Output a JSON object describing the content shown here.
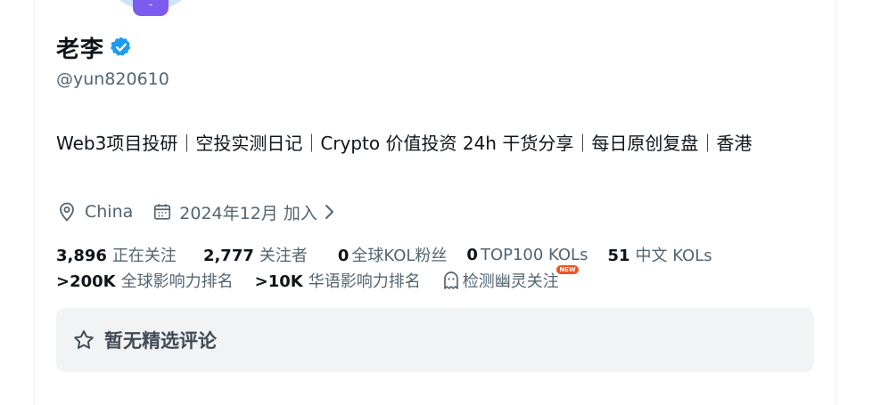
{
  "profile": {
    "name": "老李",
    "handle": "@yun820610",
    "bio": "Web3项目投研｜空投实测日记｜Crypto 价值投资 24h 干货分享｜每日原创复盘｜香港",
    "location": "China",
    "joined": "2024年12月 加入",
    "avatar_badge": "-"
  },
  "stats": {
    "following_num": "3,896",
    "following_label": "正在关注",
    "followers_num": "2,777",
    "followers_label": "关注者",
    "kol_followers_num": "0",
    "kol_followers_label": "全球KOL粉丝",
    "top100_num": "0",
    "top100_label": "TOP100 KOLs",
    "cn_kol_num": "51",
    "cn_kol_label": "中文 KOLs",
    "global_rank_num": ">200K",
    "global_rank_label": "全球影响力排名",
    "cn_rank_num": ">10K",
    "cn_rank_label": "华语影响力排名",
    "ghost_label": "检测幽灵关注",
    "new_badge": "NEW"
  },
  "featured": {
    "empty_text": "暂无精选评论"
  },
  "colors": {
    "verified_blue": "#1d9bf0",
    "muted_text": "#536471",
    "card_bg": "#f1f3f5",
    "badge_red": "#f4511e",
    "avatar_badge_purple": "#7c5cf0"
  },
  "icons": {
    "verified": "verified-badge-icon",
    "location": "location-pin-icon",
    "calendar": "calendar-icon",
    "chevron": "chevron-right-icon",
    "ghost": "ghost-icon",
    "star": "star-outline-icon"
  }
}
